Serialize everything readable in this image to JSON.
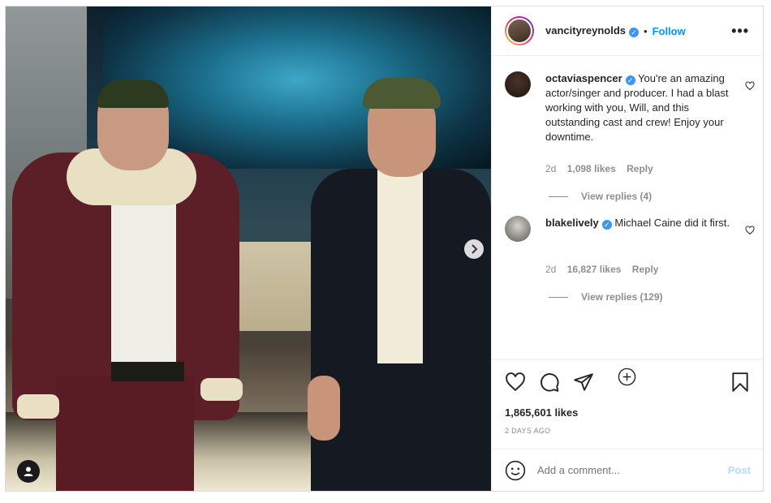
{
  "post": {
    "username": "vancityreynolds",
    "follow_label": "Follow",
    "separator": "•",
    "more_label": "•••",
    "likes": "1,865,601 likes",
    "time": "2 DAYS AGO"
  },
  "comments": [
    {
      "username": "octaviaspencer",
      "text": " You're an amazing actor/singer and producer. I had a blast working with you, Will, and this outstanding cast and crew! Enjoy your downtime.",
      "age": "2d",
      "likes": "1,098 likes",
      "reply_label": "Reply",
      "view_replies": "View replies (4)"
    },
    {
      "username": "blakelively",
      "text": " Michael Caine did it first.",
      "age": "2d",
      "likes": "16,827 likes",
      "reply_label": "Reply",
      "view_replies": "View replies (129)"
    }
  ],
  "add_comment": {
    "placeholder": "Add a comment...",
    "post_label": "Post"
  },
  "colors": {
    "accent": "#0095f6",
    "verified": "#3897f0",
    "post_disabled": "#b3dbff",
    "muted": "#8e8e8e"
  },
  "icons": {
    "next": "chevron-right-icon",
    "tag": "user-tag-icon",
    "like": "heart-icon",
    "comment": "comment-icon",
    "share": "share-icon",
    "save": "bookmark-icon",
    "load_more": "plus-circle-icon",
    "emoji": "emoji-icon"
  }
}
